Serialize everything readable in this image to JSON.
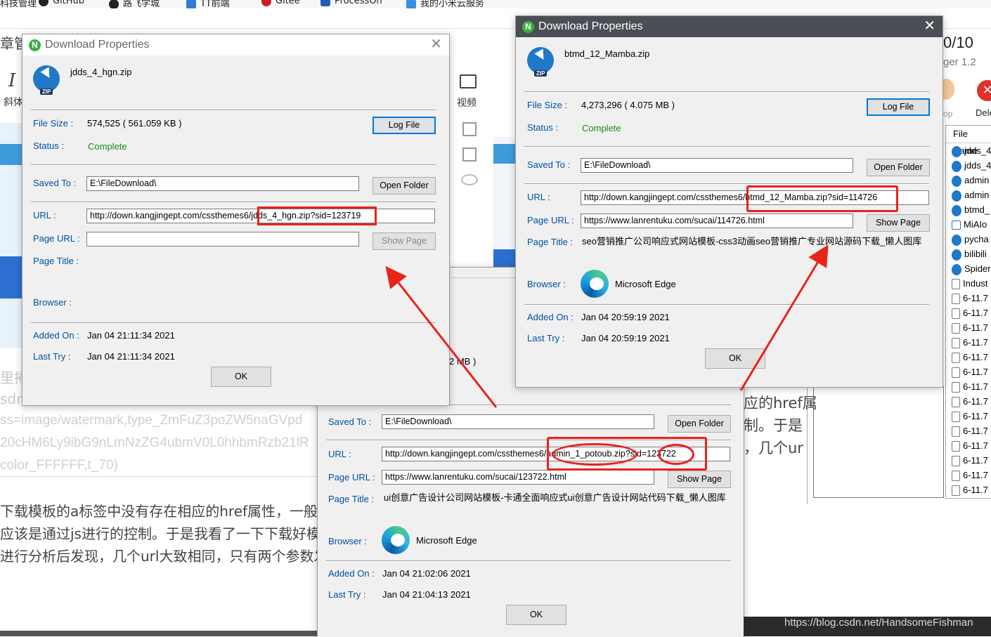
{
  "bookmarks": [
    "科技管理",
    "GitHub",
    "路飞学城",
    "TT前端",
    "Gitee",
    "ProcessOn",
    "我的小米云服务"
  ],
  "background": {
    "left_title_fragment": "章管",
    "toolbar_italic_icon": "I",
    "toolbar_italic_label": "斜体",
    "toolbar_video_label": "视频",
    "frag_li": "里掃",
    "frag_sdn": "sdn",
    "url_lines": [
      "ss=image/watermark,type_ZmFuZ3poZW5naGVpd",
      "20cHM6Ly9ibG9nLmNzZG4ubmV0L0hhbmRzb21lR",
      "color_FFFFFF,t_70)"
    ],
    "article_lines": [
      "下载模板的a标签中没有存在相应的href属性，一般下",
      "应该是通过js进行的控制。于是我看了一下下载好模板",
      "进行分析后发现，几个url大致相同，只有两个参数发"
    ],
    "right_lines": [
      "应的href属",
      "制。于是",
      "，几个ur"
    ],
    "counter": "0/10",
    "version_fragment": "ger 1.2",
    "delete_label": "Dele",
    "op_label": "op",
    "partial_size": "2 MB )"
  },
  "file_panel": {
    "header": "File Name",
    "rows": [
      {
        "icon": "zip",
        "name": "jdds_4"
      },
      {
        "icon": "zip",
        "name": "jdds_4"
      },
      {
        "icon": "zip",
        "name": "admin"
      },
      {
        "icon": "zip",
        "name": "admin"
      },
      {
        "icon": "zip",
        "name": "btmd_"
      },
      {
        "icon": "img",
        "name": "MiAIo"
      },
      {
        "icon": "zip",
        "name": "pycha"
      },
      {
        "icon": "zip",
        "name": "bilibili"
      },
      {
        "icon": "zip",
        "name": "Spider"
      },
      {
        "icon": "doc",
        "name": "Indust"
      },
      {
        "icon": "doc",
        "name": "6-11.7"
      },
      {
        "icon": "doc",
        "name": "6-11.7"
      },
      {
        "icon": "doc",
        "name": "6-11.7"
      },
      {
        "icon": "doc",
        "name": "6-11.7"
      },
      {
        "icon": "doc",
        "name": "6-11.7"
      },
      {
        "icon": "doc",
        "name": "6-11.7"
      },
      {
        "icon": "doc",
        "name": "6-11.7"
      },
      {
        "icon": "doc",
        "name": "6-11.7"
      },
      {
        "icon": "doc",
        "name": "6-11.7"
      },
      {
        "icon": "doc",
        "name": "6-11.7"
      },
      {
        "icon": "doc",
        "name": "6-11.7"
      },
      {
        "icon": "doc",
        "name": "6-11.7"
      },
      {
        "icon": "doc",
        "name": "6-11.7"
      },
      {
        "icon": "doc",
        "name": "6-11.7"
      }
    ]
  },
  "labels": {
    "file_size": "File Size :",
    "status": "Status :",
    "saved_to": "Saved To :",
    "url": "URL :",
    "page_url": "Page URL :",
    "page_title": "Page Title :",
    "browser": "Browser :",
    "added_on": "Added On :",
    "last_try": "Last Try :",
    "log_file": "Log File",
    "open_folder": "Open Folder",
    "show_page": "Show Page",
    "ok": "OK"
  },
  "dialog1": {
    "title": "Download Properties",
    "filename": "jdds_4_hgn.zip",
    "file_size": "574,525 ( 561.059 KB )",
    "status": "Complete",
    "saved_to": "E:\\FileDownload\\",
    "url_prefix": "http://down.kangjingept.com/cssthemes6/",
    "url_highlight": "jdds_4_hgn.zip?sid=123719",
    "page_url": "",
    "page_title": "",
    "browser": "",
    "added_on": "Jan 04  21:11:34 2021",
    "last_try": "Jan 04  21:11:34 2021"
  },
  "dialog2": {
    "title": "Download Properties",
    "filename": "btmd_12_Mamba.zip",
    "file_size": "4,273,296 ( 4.075 MB )",
    "status": "Complete",
    "saved_to": "E:\\FileDownload\\",
    "url_prefix": "http://down.kangjingept.com/cssthemes6/",
    "url_highlight": "btmd_12_Mamba.zip?sid=114726",
    "page_url": "https://www.lanrentuku.com/sucai/114726.html",
    "page_title": "seo营销推广公司响应式网站模板-css3动画seo营销推广专业网站源码下载_懒人图库",
    "browser": "Microsoft Edge",
    "added_on": "Jan 04  20:59:19 2021",
    "last_try": "Jan 04  20:59:19 2021"
  },
  "dialog3": {
    "saved_to": "E:\\FileDownload\\",
    "url_prefix": "http://down.kangjingept.com/cssthemes6/",
    "url_mid": "admin_1_potoub.zip",
    "url_sid_label": "?sid=",
    "url_sid_value": "123722",
    "page_url": "https://www.lanrentuku.com/sucai/123722.html",
    "page_title": "ui创意广告设计公司网站模板-卡通全面响应式ui创意广告设计网站代码下载_懒人图库",
    "browser": "Microsoft Edge",
    "added_on": "Jan 04  21:02:06 2021",
    "last_try": "Jan 04  21:04:13 2021"
  },
  "watermark": "https://blog.csdn.net/HandsomeFishman",
  "colors": {
    "annotation_red": "#e8231c",
    "label_blue": "#0050a0",
    "status_green": "#1a8a1a",
    "titlebar_dark": "#4a4f55"
  }
}
